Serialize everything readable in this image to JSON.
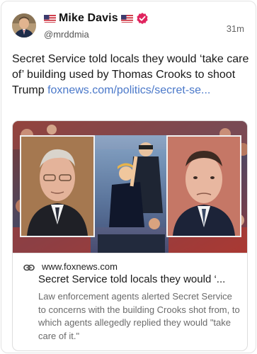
{
  "post": {
    "author": {
      "display_name": "Mike Davis",
      "handle": "@mrddmia",
      "flag_icon": "us-flag-icon",
      "verified_icon": "verified-badge-icon",
      "badge_color": "#e0245e"
    },
    "timestamp": "31m",
    "text": "Secret Service told locals they would ‘take care of’ building used by Thomas Crooks to shoot Trump ",
    "link_text": "foxnews.com/politics/secret-se...",
    "link_color": "#4a78c9"
  },
  "embed": {
    "domain": "www.foxnews.com",
    "title": "Secret Service told locals they would ‘...",
    "description": "Law enforcement agents alerted Secret Service to concerns with the building Crooks shot from, to which agents allegedly replied they would \"take care of it.\"",
    "link_icon": "link-icon"
  }
}
